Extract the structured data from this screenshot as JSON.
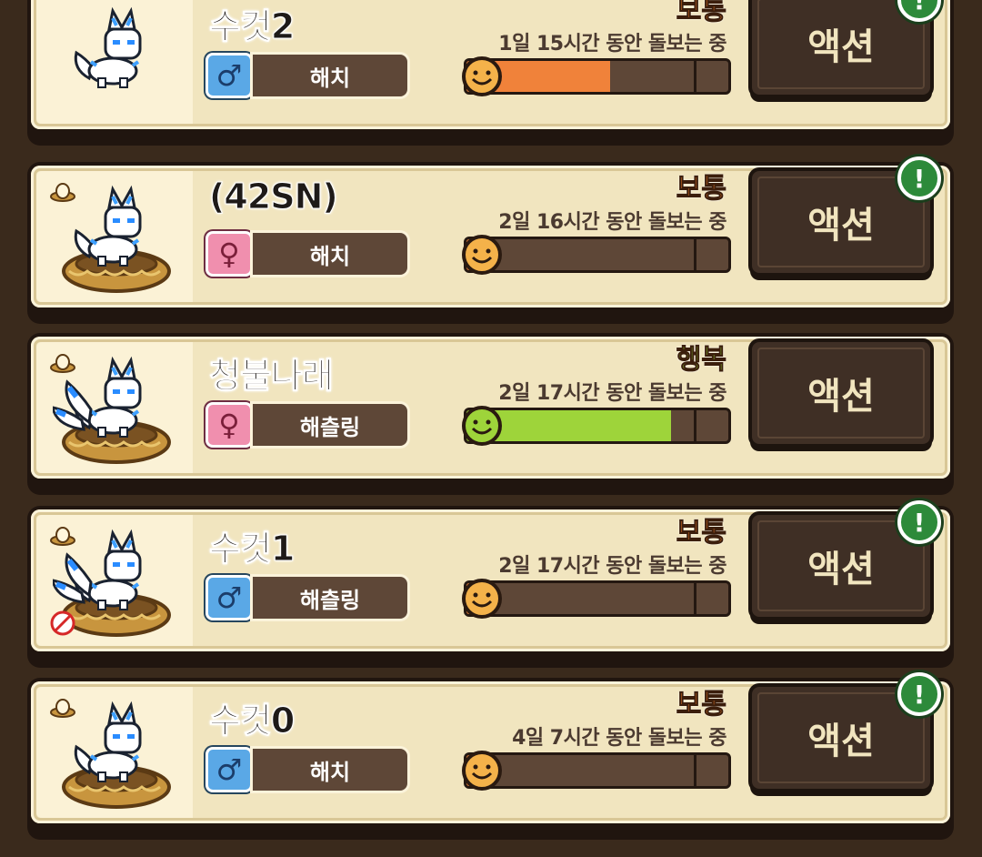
{
  "pets": [
    {
      "name": "수컷2",
      "gender": "male",
      "gender_symbol": "♂",
      "stage": "해치",
      "mood": "보통",
      "mood_type": "normal",
      "care_text": "1일 15시간 동안 돌보는 중",
      "fill_fraction": 0.55,
      "fill_color": "#f0823a",
      "face": "orange",
      "pet_sprite": "fox-small",
      "has_nest": false,
      "has_egg_icon": false,
      "has_no_icon": false,
      "action_label": "액션",
      "alert": true,
      "alert_symbol": "!"
    },
    {
      "name": "(42SN)",
      "gender": "female",
      "gender_symbol": "♀",
      "stage": "해치",
      "mood": "보통",
      "mood_type": "normal",
      "care_text": "2일 16시간 동안 돌보는 중",
      "fill_fraction": 0.05,
      "fill_color": "#f0823a",
      "face": "orange",
      "pet_sprite": "fox-small",
      "has_nest": true,
      "has_egg_icon": true,
      "has_no_icon": false,
      "action_label": "액션",
      "alert": true,
      "alert_symbol": "!"
    },
    {
      "name": "청불나래",
      "gender": "female",
      "gender_symbol": "♀",
      "stage": "해츨링",
      "mood": "행복",
      "mood_type": "happy",
      "care_text": "2일 17시간 동안 돌보는 중",
      "fill_fraction": 0.78,
      "fill_color": "#9ed43a",
      "face": "green",
      "pet_sprite": "fox-large",
      "has_nest": true,
      "has_egg_icon": true,
      "has_no_icon": false,
      "action_label": "액션",
      "alert": false,
      "alert_symbol": "!"
    },
    {
      "name": "수컷1",
      "gender": "male",
      "gender_symbol": "♂",
      "stage": "해츨링",
      "mood": "보통",
      "mood_type": "normal",
      "care_text": "2일 17시간 동안 돌보는 중",
      "fill_fraction": 0.05,
      "fill_color": "#f0823a",
      "face": "orange",
      "pet_sprite": "fox-large",
      "has_nest": true,
      "has_egg_icon": true,
      "has_no_icon": true,
      "action_label": "액션",
      "alert": true,
      "alert_symbol": "!"
    },
    {
      "name": "수컷0",
      "gender": "male",
      "gender_symbol": "♂",
      "stage": "해치",
      "mood": "보통",
      "mood_type": "normal",
      "care_text": "4일 7시간 동안 돌보는 중",
      "fill_fraction": 0.05,
      "fill_color": "#f0823a",
      "face": "orange",
      "pet_sprite": "fox-small",
      "has_nest": true,
      "has_egg_icon": true,
      "has_no_icon": false,
      "action_label": "액션",
      "alert": true,
      "alert_symbol": "!"
    }
  ]
}
